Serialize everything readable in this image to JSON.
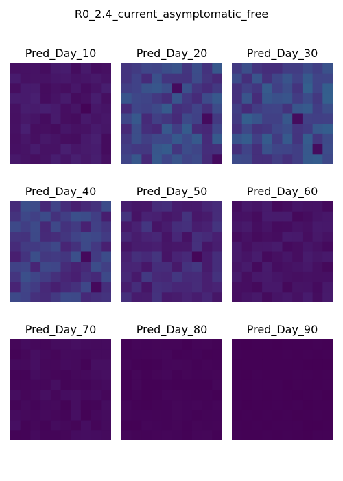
{
  "chart_data": {
    "type": "heatmap",
    "title": "R0_2.4_current_asymptomatic_free",
    "colormap": "viridis",
    "grid_rows": 10,
    "grid_cols": 10,
    "axes": "off",
    "panels": [
      {
        "title": "Pred_Day_10",
        "seed": 11,
        "base": 0.06,
        "spread": 0.03,
        "hot": [
          [
            4,
            7
          ]
        ]
      },
      {
        "title": "Pred_Day_20",
        "seed": 23,
        "base": 0.2,
        "spread": 0.09,
        "hot": [
          [
            2,
            5
          ],
          [
            9,
            9
          ],
          [
            5,
            8
          ]
        ]
      },
      {
        "title": "Pred_Day_30",
        "seed": 37,
        "base": 0.215,
        "spread": 0.09,
        "hot": [
          [
            5,
            6
          ],
          [
            8,
            8
          ]
        ]
      },
      {
        "title": "Pred_Day_40",
        "seed": 41,
        "base": 0.165,
        "spread": 0.08,
        "hot": [
          [
            5,
            7
          ],
          [
            8,
            8
          ]
        ]
      },
      {
        "title": "Pred_Day_50",
        "seed": 53,
        "base": 0.11,
        "spread": 0.06,
        "hot": [
          [
            5,
            7
          ]
        ]
      },
      {
        "title": "Pred_Day_60",
        "seed": 61,
        "base": 0.05,
        "spread": 0.03,
        "hot": []
      },
      {
        "title": "Pred_Day_70",
        "seed": 71,
        "base": 0.025,
        "spread": 0.018,
        "hot": []
      },
      {
        "title": "Pred_Day_80",
        "seed": 83,
        "base": 0.01,
        "spread": 0.008,
        "hot": []
      },
      {
        "title": "Pred_Day_90",
        "seed": 97,
        "base": 0.004,
        "spread": 0.003,
        "hot": []
      }
    ]
  }
}
